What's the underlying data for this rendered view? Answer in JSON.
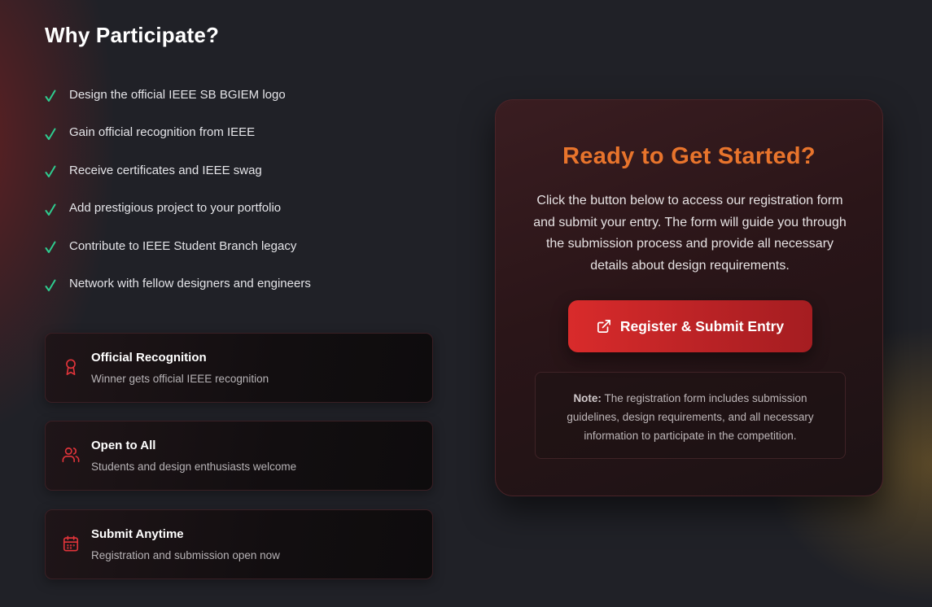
{
  "section": {
    "title": "Why Participate?",
    "benefits": [
      "Design the official IEEE SB BGIEM logo",
      "Gain official recognition from IEEE",
      "Receive certificates and IEEE swag",
      "Add prestigious project to your portfolio",
      "Contribute to IEEE Student Branch legacy",
      "Network with fellow designers and engineers"
    ]
  },
  "cards": [
    {
      "title": "Official Recognition",
      "desc": "Winner gets official IEEE recognition",
      "icon": "award-icon"
    },
    {
      "title": "Open to All",
      "desc": "Students and design enthusiasts welcome",
      "icon": "users-icon"
    },
    {
      "title": "Submit Anytime",
      "desc": "Registration and submission open now",
      "icon": "calendar-icon"
    }
  ],
  "cta": {
    "title": "Ready to Get Started?",
    "text": "Click the button below to access our registration form and submit your entry. The form will guide you through the submission process and provide all necessary details about design requirements.",
    "button_label": "Register & Submit Entry",
    "note_label": "Note:",
    "note_text": " The registration form includes submission guidelines, design requirements, and all necessary information to participate in the competition."
  },
  "colors": {
    "accent_red": "#d92b2b",
    "check_green": "#2ecc8f",
    "title_orange": "#e8742c",
    "background": "#202127"
  }
}
